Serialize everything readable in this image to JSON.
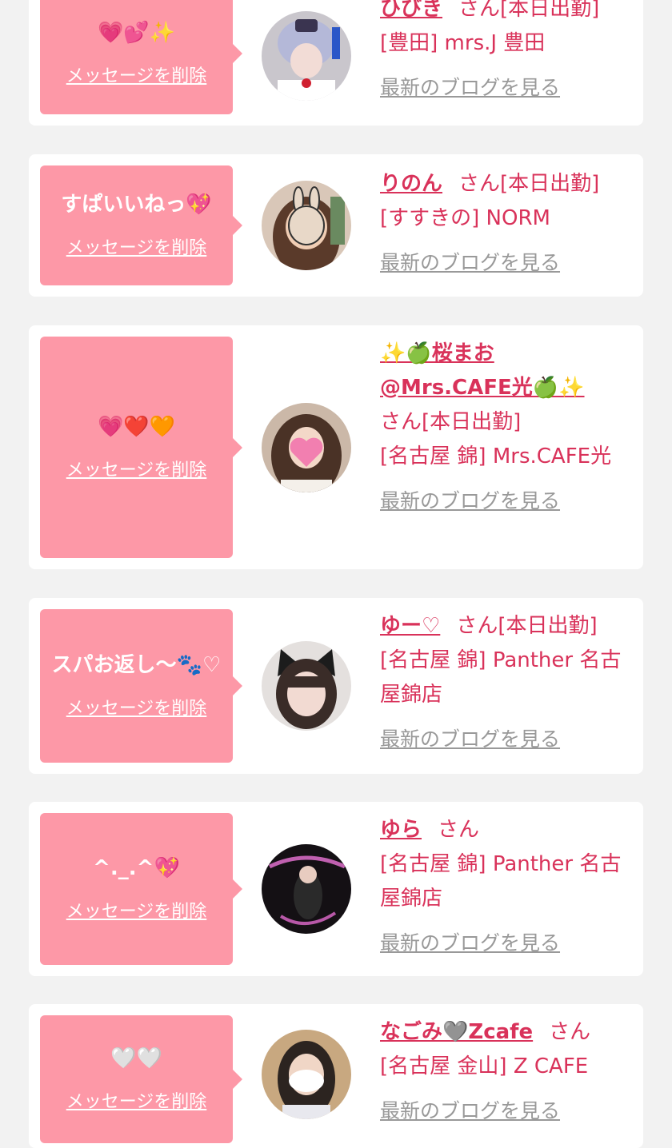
{
  "delete_label": "メッセージを削除",
  "blog_label": "最新のブログを見る",
  "cards": [
    {
      "message": "💗💕✨",
      "name": "ひびき",
      "suffix": "さん[本日出勤]",
      "shop": "[豊田] mrs.J 豊田",
      "avatar": "avatar-cosplay-photo"
    },
    {
      "message": "すぱいいねっ💖",
      "name": "りのん",
      "suffix": "さん[本日出勤]",
      "shop": "[すすきの] NORM",
      "avatar": "avatar-rabbit-mask-photo"
    },
    {
      "message": "💗❤️🧡",
      "name": "✨🍏桜まお@Mrs.CAFE光🍏✨",
      "suffix": "さん[本日出勤]",
      "shop": "[名古屋 錦] Mrs.CAFE光",
      "avatar": "avatar-heart-mask-photo"
    },
    {
      "message": "スパお返し〜🐾♡",
      "name": "ゆー♡",
      "suffix": "さん[本日出勤]",
      "shop": "[名古屋 錦] Panther 名古屋錦店",
      "avatar": "avatar-cat-ears-photo"
    },
    {
      "message": "^._.^💖",
      "name": "ゆら",
      "suffix": "さん",
      "shop": "[名古屋 錦] Panther 名古屋錦店",
      "avatar": "avatar-panther-photo"
    },
    {
      "message": "🤍🤍",
      "name": "なごみ🩶Zcafe",
      "suffix": "さん",
      "shop": "[名古屋 金山] Z CAFE",
      "avatar": "avatar-white-mask-photo"
    }
  ]
}
